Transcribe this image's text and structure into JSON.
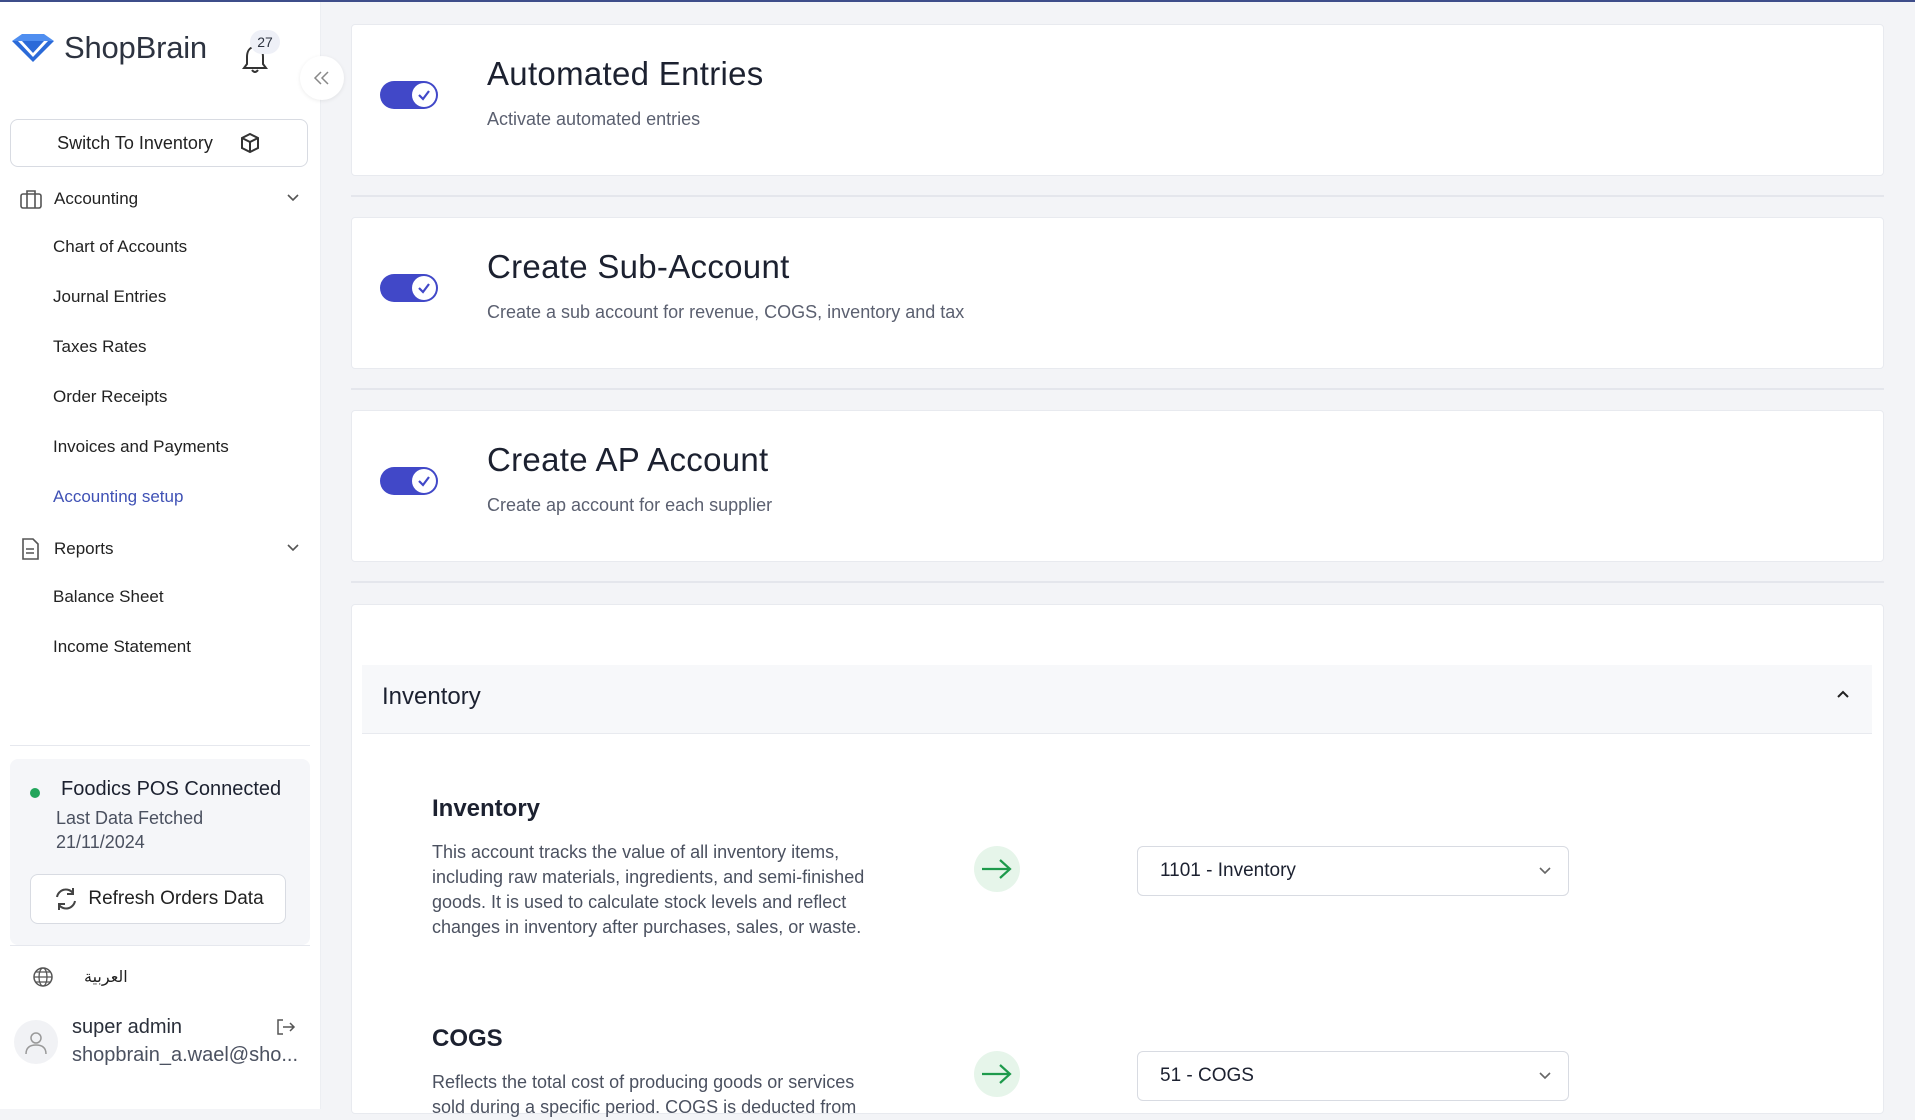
{
  "app": {
    "name": "ShopBrain",
    "notification_count": "27"
  },
  "sidebar": {
    "switch_label": "Switch To Inventory",
    "sections": [
      {
        "label": "Accounting",
        "items": [
          {
            "label": "Chart of Accounts"
          },
          {
            "label": "Journal Entries"
          },
          {
            "label": "Taxes Rates"
          },
          {
            "label": "Order Receipts"
          },
          {
            "label": "Invoices and Payments"
          },
          {
            "label": "Accounting setup",
            "active": true
          }
        ]
      },
      {
        "label": "Reports",
        "items": [
          {
            "label": "Balance Sheet"
          },
          {
            "label": "Income Statement"
          }
        ]
      }
    ],
    "integration": {
      "title": "Foodics POS Connected",
      "last_fetched_label": "Last Data Fetched",
      "last_fetched_date": "21/11/2024",
      "refresh_label": "Refresh Orders Data",
      "status_color": "#22a55b"
    },
    "language_label": "العربية",
    "user": {
      "name": "super admin",
      "email": "shopbrain_a.wael@sho..."
    }
  },
  "settings": [
    {
      "title": "Automated Entries",
      "description": "Activate automated entries",
      "enabled": true
    },
    {
      "title": "Create Sub-Account",
      "description": "Create a sub account for revenue, COGS, inventory and tax",
      "enabled": true
    },
    {
      "title": "Create AP Account",
      "description": "Create ap account for each supplier",
      "enabled": true
    }
  ],
  "inventory_section": {
    "title": "Inventory",
    "accounts": [
      {
        "title": "Inventory",
        "description": "This account tracks the value of all inventory items, including raw materials, ingredients, and semi-finished goods. It is used to calculate stock levels and reflect changes in inventory after purchases, sales, or waste.",
        "selected": "1101 - Inventory"
      },
      {
        "title": "COGS",
        "description": "Reflects the total cost of producing goods or services sold during a specific period. COGS is deducted from",
        "selected": "51 - COGS"
      }
    ]
  },
  "colors": {
    "accent": "#4148c8",
    "active_nav": "#3f51b5",
    "arrow": "#22a55b"
  }
}
